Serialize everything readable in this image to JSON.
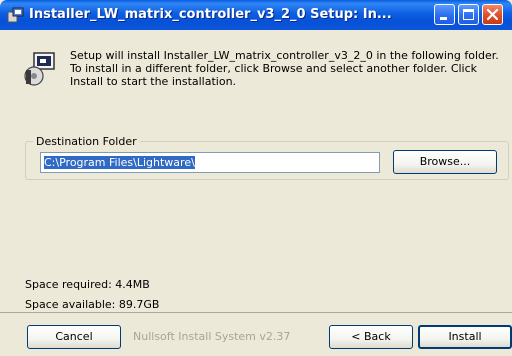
{
  "window": {
    "title": "Installer_LW_matrix_controller_v3_2_0 Setup: In...",
    "controls": {
      "minimize": "minimize-icon",
      "maximize": "maximize-icon",
      "close": "close-icon"
    }
  },
  "intro": {
    "icon": "installer-icon",
    "text": "Setup will install Installer_LW_matrix_controller_v3_2_0 in the following folder. To install in a different folder, click Browse and select another folder. Click Install to start the installation."
  },
  "destination": {
    "legend": "Destination Folder",
    "path": "C:\\Program Files\\Lightware\\",
    "browse_label": "Browse..."
  },
  "space": {
    "required": "Space required: 4.4MB",
    "available": "Space available: 89.7GB"
  },
  "footer": {
    "cancel_label": "Cancel",
    "brand": "Nullsoft Install System v2.37",
    "back_label": "< Back",
    "install_label": "Install"
  },
  "colors": {
    "titlebar": "#0a55d9",
    "dialog_bg": "#ece9d8",
    "selection": "#316ac5",
    "close_button": "#e0512d"
  }
}
